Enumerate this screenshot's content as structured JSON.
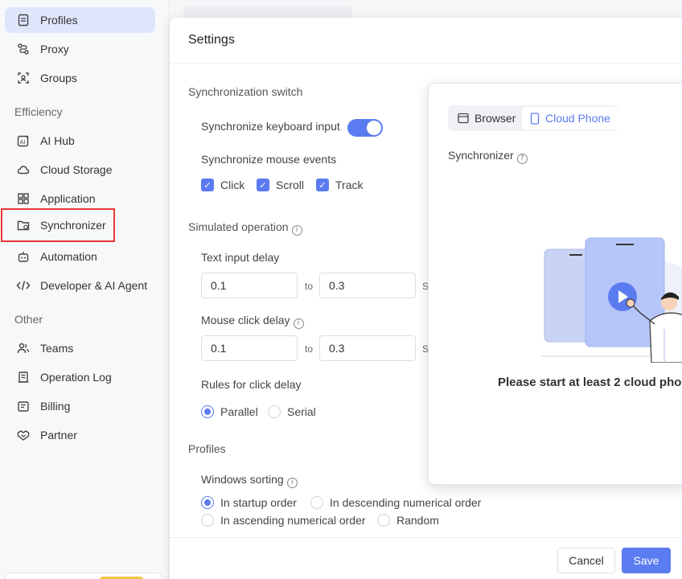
{
  "sidebar": {
    "items_top": [
      {
        "label": "Profiles",
        "icon": "file-icon"
      },
      {
        "label": "Proxy",
        "icon": "route-icon"
      },
      {
        "label": "Groups",
        "icon": "scan-icon"
      }
    ],
    "efficiency_label": "Efficiency",
    "items_efficiency": [
      {
        "label": "AI Hub",
        "icon": "ai-icon"
      },
      {
        "label": "Cloud Storage",
        "icon": "cloud-icon"
      },
      {
        "label": "Application",
        "icon": "grid-icon"
      },
      {
        "label": "Synchronizer",
        "icon": "sync-folder-icon"
      },
      {
        "label": "Automation",
        "icon": "robot-icon"
      },
      {
        "label": "Developer & AI Agent",
        "icon": "code-icon"
      }
    ],
    "other_label": "Other",
    "items_other": [
      {
        "label": "Teams",
        "icon": "users-icon"
      },
      {
        "label": "Operation Log",
        "icon": "log-icon"
      },
      {
        "label": "Billing",
        "icon": "wallet-icon"
      },
      {
        "label": "Partner",
        "icon": "handshake-icon"
      }
    ]
  },
  "modal": {
    "title": "Settings",
    "sync_switch_title": "Synchronization switch",
    "sync_keyboard_label": "Synchronize keyboard input",
    "sync_keyboard_on": true,
    "sync_mouse_label": "Synchronize mouse events",
    "mouse_options": [
      "Click",
      "Scroll",
      "Track"
    ],
    "simulated_title": "Simulated operation",
    "text_delay_label": "Text input delay",
    "text_delay_from": "0.1",
    "text_delay_to": "0.3",
    "to_word": "to",
    "unit": "S",
    "mouse_delay_label": "Mouse click delay",
    "mouse_delay_from": "0.1",
    "mouse_delay_to": "0.3",
    "rules_label": "Rules for click delay",
    "rules_options": [
      "Parallel",
      "Serial"
    ],
    "rules_selected": "Parallel",
    "profiles_title": "Profiles",
    "windows_sorting_label": "Windows sorting",
    "sorting_options": [
      "In startup order",
      "In descending numerical order",
      "In ascending numerical order",
      "Random"
    ],
    "sorting_selected": "In startup order",
    "cancel_label": "Cancel",
    "save_label": "Save"
  },
  "preview": {
    "tab_browser": "Browser",
    "tab_cloud_phone": "Cloud Phone",
    "active_tab": "Cloud Phone",
    "synchronizer_label": "Synchronizer",
    "message": "Please start at least 2 cloud pho"
  },
  "colors": {
    "accent": "#5b7bf0",
    "active_nav_bg": "#dfe5fb",
    "highlight_border": "#e53935"
  }
}
